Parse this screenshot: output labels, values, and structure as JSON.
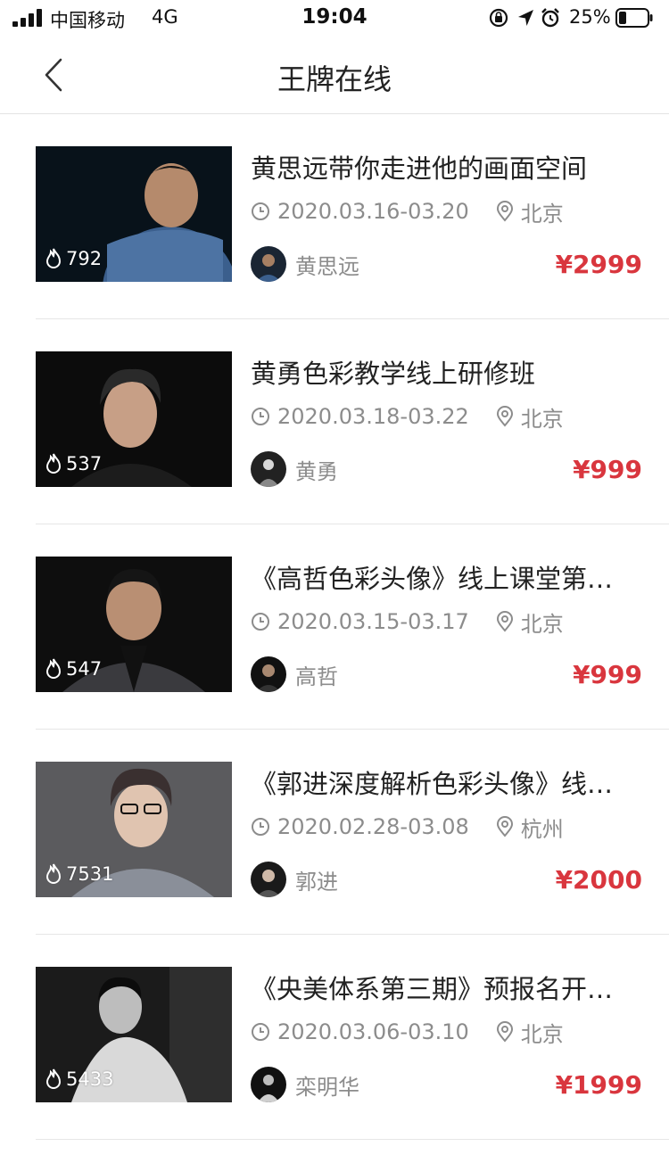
{
  "status": {
    "carrier": "中国移动",
    "network": "4G",
    "time": "19:04",
    "battery": "25%"
  },
  "nav": {
    "title": "王牌在线",
    "back_icon": "chevron-left-icon"
  },
  "colors": {
    "price": "#d9363e",
    "muted": "#8c8c8c",
    "divider": "#e6e6e6"
  },
  "courses": [
    {
      "title": "黄思远带你走进他的画面空间",
      "date": "2020.03.16-03.20",
      "location": "北京",
      "author": "黄思远",
      "price": "¥2999",
      "heat": "792"
    },
    {
      "title": "黄勇色彩教学线上研修班",
      "date": "2020.03.18-03.22",
      "location": "北京",
      "author": "黄勇",
      "price": "¥999",
      "heat": "537"
    },
    {
      "title": "《高哲色彩头像》线上课堂第…",
      "date": "2020.03.15-03.17",
      "location": "北京",
      "author": "高哲",
      "price": "¥999",
      "heat": "547"
    },
    {
      "title": "《郭进深度解析色彩头像》线…",
      "date": "2020.02.28-03.08",
      "location": "杭州",
      "author": "郭进",
      "price": "¥2000",
      "heat": "7531"
    },
    {
      "title": "《央美体系第三期》预报名开…",
      "date": "2020.03.06-03.10",
      "location": "北京",
      "author": "栾明华",
      "price": "¥1999",
      "heat": "5433"
    }
  ]
}
